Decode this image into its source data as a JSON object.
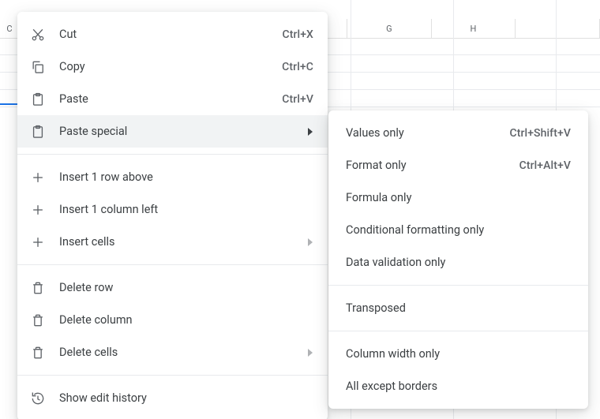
{
  "grid": {
    "columns": [
      "G",
      "H"
    ],
    "cropped_left": "C"
  },
  "context_menu": {
    "groups": [
      [
        {
          "icon": "cut-icon",
          "label": "Cut",
          "shortcut": "Ctrl+X"
        },
        {
          "icon": "copy-icon",
          "label": "Copy",
          "shortcut": "Ctrl+C"
        },
        {
          "icon": "clipboard-icon",
          "label": "Paste",
          "shortcut": "Ctrl+V"
        },
        {
          "icon": "clipboard-icon",
          "label": "Paste special",
          "submenu": true,
          "hover": true
        }
      ],
      [
        {
          "icon": "plus-icon",
          "label": "Insert 1 row above"
        },
        {
          "icon": "plus-icon",
          "label": "Insert 1 column left"
        },
        {
          "icon": "plus-icon",
          "label": "Insert cells",
          "submenu": true
        }
      ],
      [
        {
          "icon": "trash-icon",
          "label": "Delete row"
        },
        {
          "icon": "trash-icon",
          "label": "Delete column"
        },
        {
          "icon": "trash-icon",
          "label": "Delete cells",
          "submenu": true
        }
      ],
      [
        {
          "icon": "history-icon",
          "label": "Show edit history"
        }
      ]
    ]
  },
  "paste_special_submenu": {
    "groups": [
      [
        {
          "label": "Values only",
          "shortcut": "Ctrl+Shift+V"
        },
        {
          "label": "Format only",
          "shortcut": "Ctrl+Alt+V"
        },
        {
          "label": "Formula only"
        },
        {
          "label": "Conditional formatting only"
        },
        {
          "label": "Data validation only"
        }
      ],
      [
        {
          "label": "Transposed"
        }
      ],
      [
        {
          "label": "Column width only"
        },
        {
          "label": "All except borders"
        }
      ]
    ]
  }
}
